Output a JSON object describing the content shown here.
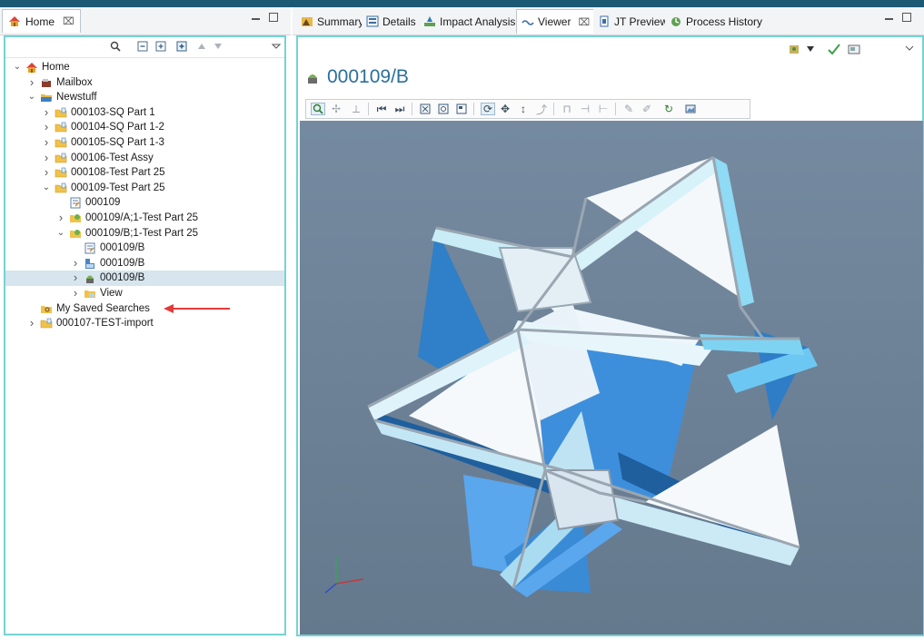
{
  "left_panel": {
    "tab": {
      "label": "Home",
      "close": "⌧"
    }
  },
  "tree": [
    {
      "label": "Home",
      "level": 0,
      "twisty": "open",
      "icon": "home-icon"
    },
    {
      "label": "Mailbox",
      "level": 1,
      "twisty": "closed",
      "icon": "mailbox-icon"
    },
    {
      "label": "Newstuff",
      "level": 1,
      "twisty": "open",
      "icon": "folder-open-icon"
    },
    {
      "label": "000103-SQ Part 1",
      "level": 2,
      "twisty": "closed",
      "icon": "item-folder-icon"
    },
    {
      "label": "000104-SQ Part 1-2",
      "level": 2,
      "twisty": "closed",
      "icon": "item-folder-icon"
    },
    {
      "label": "000105-SQ Part 1-3",
      "level": 2,
      "twisty": "closed",
      "icon": "item-folder-icon"
    },
    {
      "label": "000106-Test Assy",
      "level": 2,
      "twisty": "closed",
      "icon": "item-folder-icon"
    },
    {
      "label": "000108-Test Part 25",
      "level": 2,
      "twisty": "closed",
      "icon": "item-folder-icon"
    },
    {
      "label": "000109-Test Part 25",
      "level": 2,
      "twisty": "open",
      "icon": "item-folder-icon"
    },
    {
      "label": "000109",
      "level": 3,
      "twisty": "none",
      "icon": "form-icon"
    },
    {
      "label": "000109/A;1-Test Part 25",
      "level": 3,
      "twisty": "closed",
      "icon": "revision-icon"
    },
    {
      "label": "000109/B;1-Test Part 25",
      "level": 3,
      "twisty": "open",
      "icon": "revision-icon"
    },
    {
      "label": "000109/B",
      "level": 4,
      "twisty": "none",
      "icon": "form-icon"
    },
    {
      "label": "000109/B",
      "level": 4,
      "twisty": "closed",
      "icon": "bom-view-icon"
    },
    {
      "label": "000109/B",
      "level": 4,
      "twisty": "closed",
      "icon": "dataset-jt-icon",
      "selected": true
    },
    {
      "label": "View",
      "level": 4,
      "twisty": "closed",
      "icon": "view-folder-icon"
    },
    {
      "label": "My Saved Searches",
      "level": 1,
      "twisty": "none",
      "icon": "search-folder-icon"
    },
    {
      "label": "000107-TEST-import",
      "level": 1,
      "twisty": "closed",
      "icon": "item-folder-icon"
    }
  ],
  "right_panel": {
    "tabs": [
      {
        "label": "Summary",
        "icon": "summary-icon"
      },
      {
        "label": "Details",
        "icon": "details-icon"
      },
      {
        "label": "Impact Analysis",
        "icon": "impact-analysis-icon"
      },
      {
        "label": "Viewer",
        "icon": "viewer-icon",
        "active": true,
        "close": "⌧"
      },
      {
        "label": "JT Preview",
        "icon": "jt-preview-icon"
      },
      {
        "label": "Process History",
        "icon": "process-history-icon"
      }
    ],
    "title": "000109/B"
  },
  "colors": {
    "accent_frame": "#74d3d3",
    "title_blue": "#2a6f9b",
    "viewport_bg": "#6e8297",
    "selection": "#d6e5ee",
    "arrow": "#e23b3b"
  }
}
